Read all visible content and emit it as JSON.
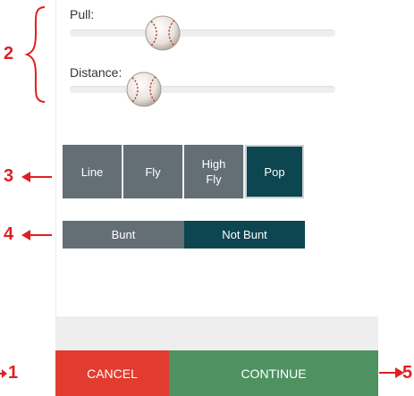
{
  "sliders": [
    {
      "label": "Pull:",
      "value": 0.34
    },
    {
      "label": "Distance:",
      "value": 0.25
    }
  ],
  "hit_type": {
    "options": [
      "Line",
      "Fly",
      "High\nFly",
      "Pop"
    ],
    "selected": "Pop"
  },
  "bunt": {
    "options": [
      "Bunt",
      "Not Bunt"
    ],
    "selected": "Not Bunt"
  },
  "footer": {
    "cancel_label": "CANCEL",
    "continue_label": "CONTINUE"
  },
  "annotations": [
    "1",
    "2",
    "3",
    "4",
    "5"
  ],
  "colors": {
    "segment_default": "#636e75",
    "segment_selected": "#0c4650",
    "cancel": "#e23b2f",
    "continue": "#4f9262",
    "annotation": "#e02020"
  },
  "icons": [
    "baseball-icon",
    "arrow-left-icon",
    "arrow-right-icon",
    "brace-icon"
  ]
}
